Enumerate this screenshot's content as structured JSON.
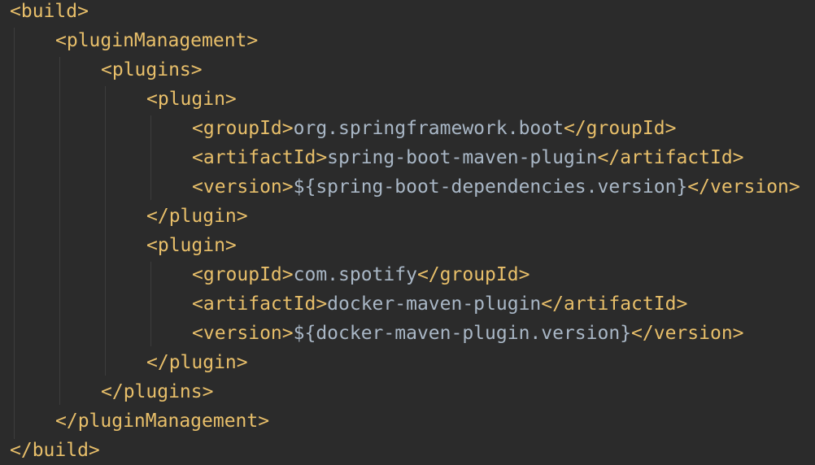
{
  "code": {
    "lines": [
      {
        "open": "<build>",
        "text": "",
        "close": ""
      },
      {
        "open": "<pluginManagement>",
        "text": "",
        "close": ""
      },
      {
        "open": "<plugins>",
        "text": "",
        "close": ""
      },
      {
        "open": "<plugin>",
        "text": "",
        "close": ""
      },
      {
        "open": "<groupId>",
        "text": "org.springframework.boot",
        "close": "</groupId>"
      },
      {
        "open": "<artifactId>",
        "text": "spring-boot-maven-plugin",
        "close": "</artifactId>"
      },
      {
        "open": "<version>",
        "text": "${spring-boot-dependencies.version}",
        "close": "</version>"
      },
      {
        "open": "</plugin>",
        "text": "",
        "close": ""
      },
      {
        "open": "<plugin>",
        "text": "",
        "close": ""
      },
      {
        "open": "<groupId>",
        "text": "com.spotify",
        "close": "</groupId>"
      },
      {
        "open": "<artifactId>",
        "text": "docker-maven-plugin",
        "close": "</artifactId>"
      },
      {
        "open": "<version>",
        "text": "${docker-maven-plugin.version}",
        "close": "</version>"
      },
      {
        "open": "</plugin>",
        "text": "",
        "close": ""
      },
      {
        "open": "</plugins>",
        "text": "",
        "close": ""
      },
      {
        "open": "</pluginManagement>",
        "text": "",
        "close": ""
      },
      {
        "open": "</build>",
        "text": "",
        "close": ""
      }
    ]
  },
  "colors": {
    "background": "#2b2b2b",
    "tag": "#e8bf6a",
    "text": "#a9b7c6",
    "indent_guide": "#3d3d3d"
  }
}
